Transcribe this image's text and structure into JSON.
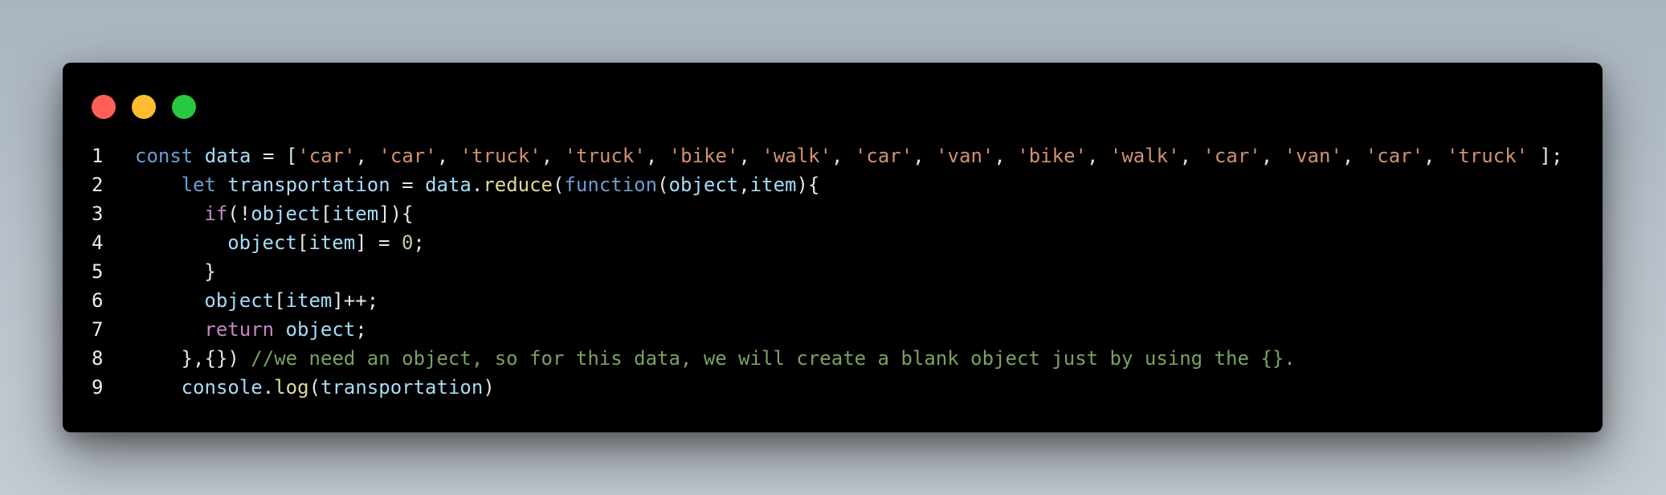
{
  "window": {
    "buttons": [
      {
        "name": "close",
        "color": "#ff5f57"
      },
      {
        "name": "minimize",
        "color": "#febc2e"
      },
      {
        "name": "maximize",
        "color": "#28c840"
      }
    ]
  },
  "code": {
    "language": "javascript",
    "lines": [
      {
        "num": "1",
        "indent": 0,
        "tokens": [
          {
            "t": "const",
            "c": "kw"
          },
          {
            "t": " ",
            "c": "pn"
          },
          {
            "t": "data",
            "c": "var"
          },
          {
            "t": " = [",
            "c": "pn"
          },
          {
            "t": "'car'",
            "c": "str"
          },
          {
            "t": ", ",
            "c": "pn"
          },
          {
            "t": "'car'",
            "c": "str"
          },
          {
            "t": ", ",
            "c": "pn"
          },
          {
            "t": "'truck'",
            "c": "str"
          },
          {
            "t": ", ",
            "c": "pn"
          },
          {
            "t": "'truck'",
            "c": "str"
          },
          {
            "t": ", ",
            "c": "pn"
          },
          {
            "t": "'bike'",
            "c": "str"
          },
          {
            "t": ", ",
            "c": "pn"
          },
          {
            "t": "'walk'",
            "c": "str"
          },
          {
            "t": ", ",
            "c": "pn"
          },
          {
            "t": "'car'",
            "c": "str"
          },
          {
            "t": ", ",
            "c": "pn"
          },
          {
            "t": "'van'",
            "c": "str"
          },
          {
            "t": ", ",
            "c": "pn"
          },
          {
            "t": "'bike'",
            "c": "str"
          },
          {
            "t": ", ",
            "c": "pn"
          },
          {
            "t": "'walk'",
            "c": "str"
          },
          {
            "t": ", ",
            "c": "pn"
          },
          {
            "t": "'car'",
            "c": "str"
          },
          {
            "t": ", ",
            "c": "pn"
          },
          {
            "t": "'van'",
            "c": "str"
          },
          {
            "t": ", ",
            "c": "pn"
          },
          {
            "t": "'car'",
            "c": "str"
          },
          {
            "t": ", ",
            "c": "pn"
          },
          {
            "t": "'truck'",
            "c": "str"
          },
          {
            "t": " ];",
            "c": "pn"
          }
        ]
      },
      {
        "num": "2",
        "indent": 4,
        "tokens": [
          {
            "t": "let",
            "c": "kw"
          },
          {
            "t": " ",
            "c": "pn"
          },
          {
            "t": "transportation",
            "c": "var"
          },
          {
            "t": " = ",
            "c": "pn"
          },
          {
            "t": "data",
            "c": "var"
          },
          {
            "t": ".",
            "c": "pn"
          },
          {
            "t": "reduce",
            "c": "fn"
          },
          {
            "t": "(",
            "c": "pn"
          },
          {
            "t": "function",
            "c": "kw"
          },
          {
            "t": "(",
            "c": "pn"
          },
          {
            "t": "object",
            "c": "var"
          },
          {
            "t": ",",
            "c": "pn"
          },
          {
            "t": "item",
            "c": "var"
          },
          {
            "t": "){",
            "c": "pn"
          }
        ]
      },
      {
        "num": "3",
        "indent": 6,
        "tokens": [
          {
            "t": "if",
            "c": "kw2"
          },
          {
            "t": "(!",
            "c": "pn"
          },
          {
            "t": "object",
            "c": "var"
          },
          {
            "t": "[",
            "c": "pn"
          },
          {
            "t": "item",
            "c": "var"
          },
          {
            "t": "]){",
            "c": "pn"
          }
        ]
      },
      {
        "num": "4",
        "indent": 8,
        "tokens": [
          {
            "t": "object",
            "c": "var"
          },
          {
            "t": "[",
            "c": "pn"
          },
          {
            "t": "item",
            "c": "var"
          },
          {
            "t": "] = ",
            "c": "pn"
          },
          {
            "t": "0",
            "c": "num"
          },
          {
            "t": ";",
            "c": "pn"
          }
        ]
      },
      {
        "num": "5",
        "indent": 6,
        "tokens": [
          {
            "t": "}",
            "c": "pn"
          }
        ]
      },
      {
        "num": "6",
        "indent": 6,
        "tokens": [
          {
            "t": "object",
            "c": "var"
          },
          {
            "t": "[",
            "c": "pn"
          },
          {
            "t": "item",
            "c": "var"
          },
          {
            "t": "]++;",
            "c": "pn"
          }
        ]
      },
      {
        "num": "7",
        "indent": 6,
        "tokens": [
          {
            "t": "return",
            "c": "kw2"
          },
          {
            "t": " ",
            "c": "pn"
          },
          {
            "t": "object",
            "c": "var"
          },
          {
            "t": ";",
            "c": "pn"
          }
        ]
      },
      {
        "num": "8",
        "indent": 4,
        "tokens": [
          {
            "t": "},{}) ",
            "c": "pn"
          },
          {
            "t": "//we need an object, so for this data, we will create a blank object just by using the {}.",
            "c": "cm"
          }
        ]
      },
      {
        "num": "9",
        "indent": 4,
        "tokens": [
          {
            "t": "console",
            "c": "var"
          },
          {
            "t": ".",
            "c": "pn"
          },
          {
            "t": "log",
            "c": "fn"
          },
          {
            "t": "(",
            "c": "pn"
          },
          {
            "t": "transportation",
            "c": "var"
          },
          {
            "t": ")",
            "c": "pn"
          }
        ]
      }
    ]
  }
}
